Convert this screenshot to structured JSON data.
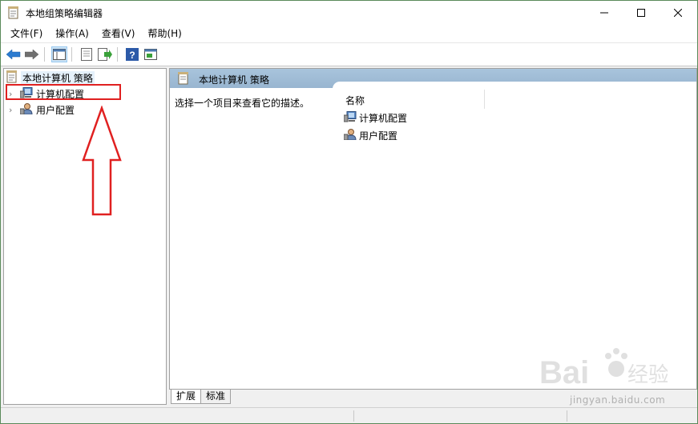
{
  "window": {
    "title": "本地组策略编辑器"
  },
  "menu": [
    {
      "label": "文件(F)"
    },
    {
      "label": "操作(A)"
    },
    {
      "label": "查看(V)"
    },
    {
      "label": "帮助(H)"
    }
  ],
  "toolbar": {
    "buttons": [
      "back-arrow-icon",
      "forward-arrow-icon",
      "show-tree-icon",
      "properties-icon",
      "export-list-icon",
      "help-icon",
      "show-action-pane-icon"
    ]
  },
  "tree": {
    "root": "本地计算机 策略",
    "nodes": [
      {
        "label": "计算机配置"
      },
      {
        "label": "用户配置"
      }
    ]
  },
  "right_pane": {
    "header": "本地计算机 策略",
    "description": "选择一个项目来查看它的描述。",
    "column_name": "名称",
    "items": [
      {
        "label": "计算机配置"
      },
      {
        "label": "用户配置"
      }
    ]
  },
  "tabs": [
    {
      "label": "扩展",
      "active": true
    },
    {
      "label": "标准",
      "active": false
    }
  ],
  "watermark": {
    "url": "jingyan.baidu.com"
  },
  "colors": {
    "annotation_red": "#e02020",
    "header_blue": "#a8c4dc",
    "selection": "#e5f1fb"
  }
}
